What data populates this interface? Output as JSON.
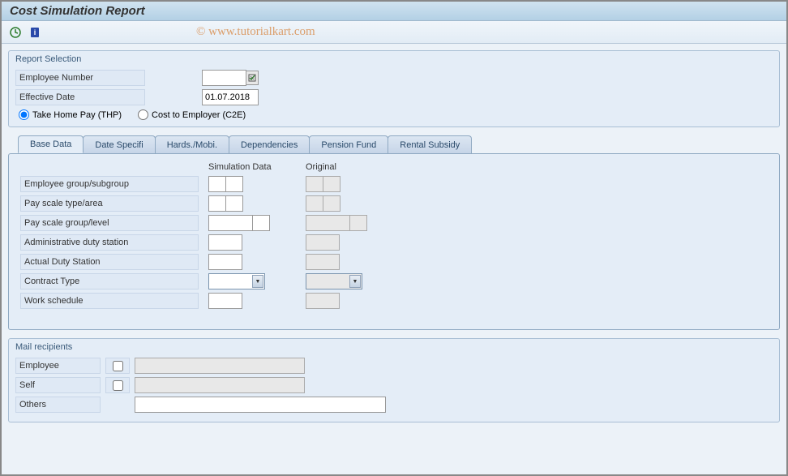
{
  "title": "Cost Simulation Report",
  "watermark": "© www.tutorialkart.com",
  "toolbar": {
    "execute_icon": "clock-execute",
    "info_icon": "info"
  },
  "report_selection": {
    "title": "Report Selection",
    "employee_number_label": "Employee Number",
    "employee_number_value": "",
    "effective_date_label": "Effective Date",
    "effective_date_value": "01.07.2018",
    "radio_thp_label": "Take Home Pay (THP)",
    "radio_c2e_label": "Cost to Employer (C2E)",
    "radio_selected": "thp"
  },
  "tabs": [
    {
      "id": "base",
      "label": "Base Data",
      "active": true
    },
    {
      "id": "date",
      "label": "Date Specifi",
      "active": false
    },
    {
      "id": "hards",
      "label": "Hards./Mobi.",
      "active": false
    },
    {
      "id": "deps",
      "label": "Dependencies",
      "active": false
    },
    {
      "id": "pension",
      "label": "Pension Fund",
      "active": false
    },
    {
      "id": "rental",
      "label": "Rental Subsidy",
      "active": false
    }
  ],
  "base_data": {
    "col_sim": "Simulation Data",
    "col_orig": "Original",
    "rows": [
      {
        "label": "Employee group/subgroup",
        "type": "double-sm"
      },
      {
        "label": "Pay scale type/area",
        "type": "double-sm"
      },
      {
        "label": "Pay scale group/level",
        "type": "group-level"
      },
      {
        "label": "Administrative duty station",
        "type": "single"
      },
      {
        "label": "Actual Duty Station",
        "type": "single"
      },
      {
        "label": "Contract Type",
        "type": "combo"
      },
      {
        "label": "Work schedule",
        "type": "single"
      }
    ]
  },
  "mail": {
    "title": "Mail recipients",
    "employee_label": "Employee",
    "self_label": "Self",
    "others_label": "Others",
    "employee_checked": false,
    "self_checked": false
  }
}
